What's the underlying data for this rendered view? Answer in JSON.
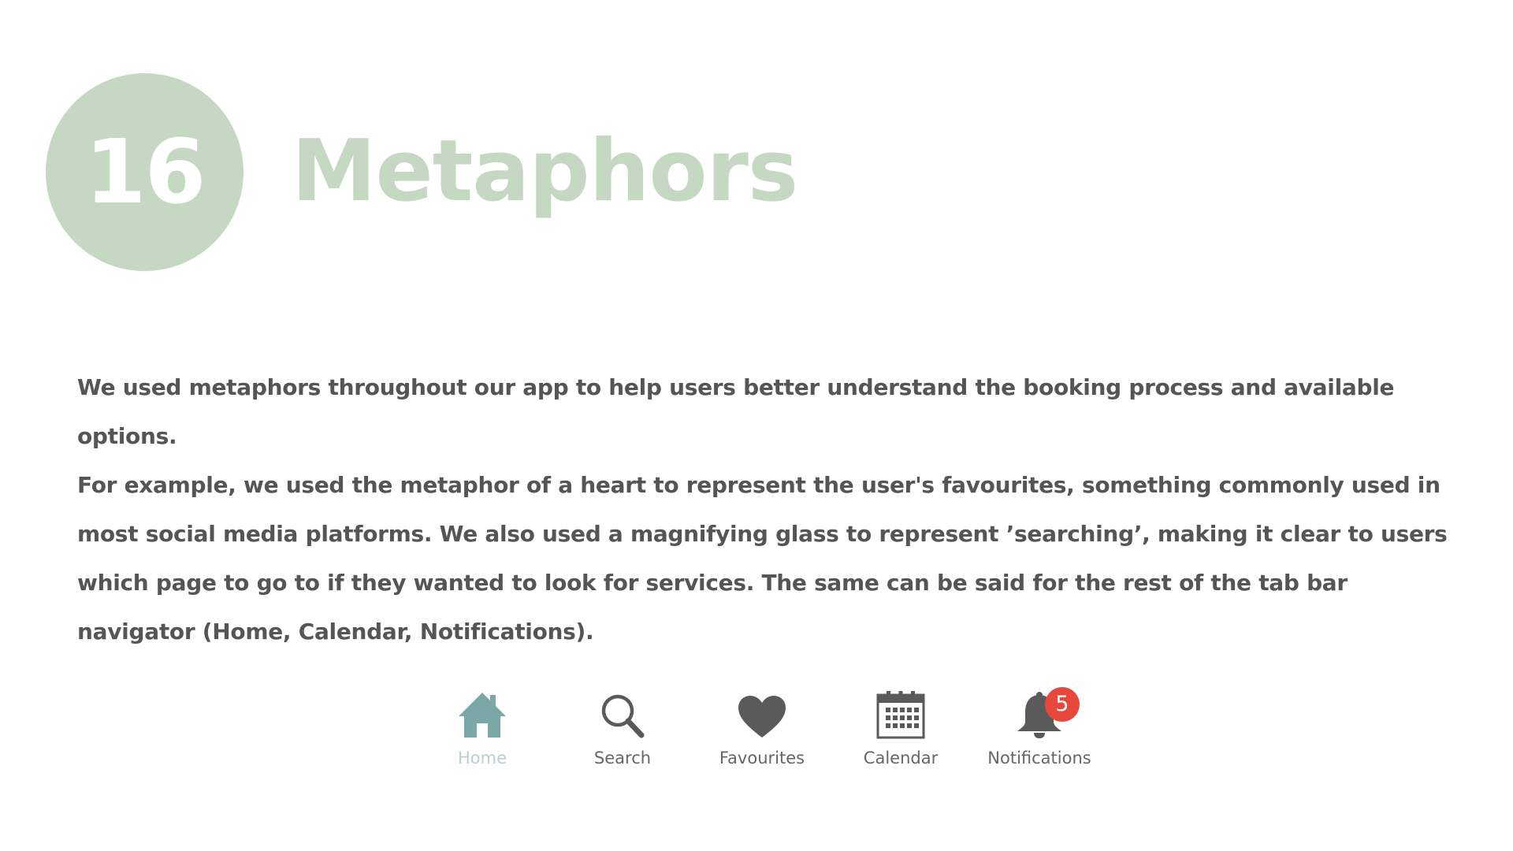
{
  "slide": {
    "number": "16",
    "title": "Metaphors",
    "paragraph_1": "We used metaphors throughout our app to help users better understand the booking process and available options.",
    "paragraph_2": "For example, we used the metaphor of a heart to represent the user's favourites, something commonly used in most social media platforms. We also used a magnifying glass to represent ’searching’, making it clear to users which page to go to if they wanted to look for services. The same can be said for the rest of the tab bar navigator (Home, Calendar, Notifications)."
  },
  "colors": {
    "accent_green": "#c5d8c2",
    "home_active": "#7aa8a6",
    "home_label_active": "#b4d2cf",
    "icon_gray": "#5a5a5a",
    "badge_red": "#e8473c",
    "body_text": "#555555"
  },
  "tab_bar": {
    "tabs": [
      {
        "label": "Home",
        "icon": "home-icon",
        "active": true
      },
      {
        "label": "Search",
        "icon": "magnifying-glass-icon",
        "active": false
      },
      {
        "label": "Favourites",
        "icon": "heart-icon",
        "active": false
      },
      {
        "label": "Calendar",
        "icon": "calendar-icon",
        "active": false
      },
      {
        "label": "Notifications",
        "icon": "bell-icon",
        "active": false,
        "badge": "5"
      }
    ]
  }
}
